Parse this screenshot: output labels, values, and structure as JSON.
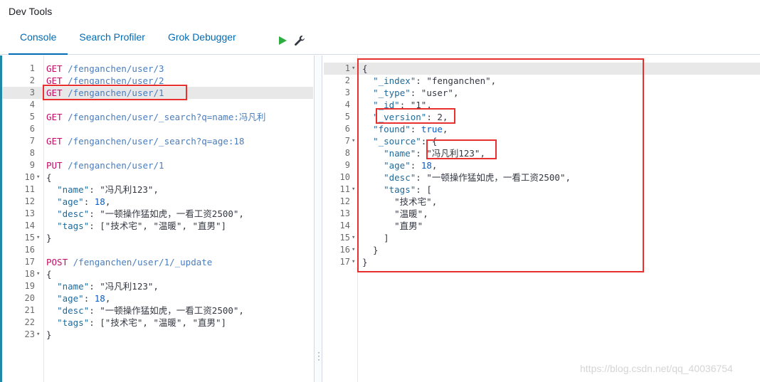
{
  "app": {
    "title": "Dev Tools"
  },
  "tabs": [
    {
      "label": "Console",
      "active": true
    },
    {
      "label": "Search Profiler",
      "active": false
    },
    {
      "label": "Grok Debugger",
      "active": false
    }
  ],
  "request_editor": {
    "lines": [
      {
        "n": "1",
        "tokens": [
          [
            "m",
            "GET "
          ],
          [
            "p",
            "/fenganchen/user/3"
          ]
        ]
      },
      {
        "n": "2",
        "tokens": [
          [
            "m",
            "GET "
          ],
          [
            "p",
            "/fenganchen/user/2"
          ]
        ]
      },
      {
        "n": "3",
        "tokens": [
          [
            "m",
            "GET "
          ],
          [
            "p",
            "/fenganchen/user/1"
          ]
        ],
        "active": true
      },
      {
        "n": "4",
        "tokens": []
      },
      {
        "n": "5",
        "tokens": [
          [
            "m",
            "GET "
          ],
          [
            "p",
            "/fenganchen/user/_search?q=name:冯凡利"
          ]
        ]
      },
      {
        "n": "6",
        "tokens": []
      },
      {
        "n": "7",
        "tokens": [
          [
            "m",
            "GET "
          ],
          [
            "p",
            "/fenganchen/user/_search?q=age:18"
          ]
        ]
      },
      {
        "n": "8",
        "tokens": []
      },
      {
        "n": "9",
        "tokens": [
          [
            "m",
            "PUT "
          ],
          [
            "p",
            "/fenganchen/user/1"
          ]
        ]
      },
      {
        "n": "10",
        "fold": true,
        "tokens": [
          [
            "s",
            "{"
          ]
        ]
      },
      {
        "n": "11",
        "tokens": [
          [
            "s",
            "  "
          ],
          [
            "k",
            "\"name\""
          ],
          [
            "s",
            ": \"冯凡利123\","
          ]
        ]
      },
      {
        "n": "12",
        "tokens": [
          [
            "s",
            "  "
          ],
          [
            "k",
            "\"age\""
          ],
          [
            "s",
            ": "
          ],
          [
            "n",
            "18"
          ],
          [
            "s",
            ","
          ]
        ]
      },
      {
        "n": "13",
        "tokens": [
          [
            "s",
            "  "
          ],
          [
            "k",
            "\"desc\""
          ],
          [
            "s",
            ": \"一顿操作猛如虎，一看工资2500\","
          ]
        ]
      },
      {
        "n": "14",
        "tokens": [
          [
            "s",
            "  "
          ],
          [
            "k",
            "\"tags\""
          ],
          [
            "s",
            ": [\"技术宅\", \"温暖\", \"直男\"]"
          ]
        ]
      },
      {
        "n": "15",
        "fold": true,
        "tokens": [
          [
            "s",
            "}"
          ]
        ]
      },
      {
        "n": "16",
        "tokens": []
      },
      {
        "n": "17",
        "tokens": [
          [
            "m",
            "POST "
          ],
          [
            "p",
            "/fenganchen/user/1/_update"
          ]
        ]
      },
      {
        "n": "18",
        "fold": true,
        "tokens": [
          [
            "s",
            "{"
          ]
        ]
      },
      {
        "n": "19",
        "tokens": [
          [
            "s",
            "  "
          ],
          [
            "k",
            "\"name\""
          ],
          [
            "s",
            ": \"冯凡利123\","
          ]
        ]
      },
      {
        "n": "20",
        "tokens": [
          [
            "s",
            "  "
          ],
          [
            "k",
            "\"age\""
          ],
          [
            "s",
            ": "
          ],
          [
            "n",
            "18"
          ],
          [
            "s",
            ","
          ]
        ]
      },
      {
        "n": "21",
        "tokens": [
          [
            "s",
            "  "
          ],
          [
            "k",
            "\"desc\""
          ],
          [
            "s",
            ": \"一顿操作猛如虎，一看工资2500\","
          ]
        ]
      },
      {
        "n": "22",
        "tokens": [
          [
            "s",
            "  "
          ],
          [
            "k",
            "\"tags\""
          ],
          [
            "s",
            ": [\"技术宅\", \"温暖\", \"直男\"]"
          ]
        ]
      },
      {
        "n": "23",
        "fold": true,
        "tokens": [
          [
            "s",
            "}"
          ]
        ]
      }
    ]
  },
  "response_editor": {
    "lines": [
      {
        "n": "1",
        "fold": true,
        "tokens": [
          [
            "s",
            "{"
          ]
        ],
        "active": true
      },
      {
        "n": "2",
        "tokens": [
          [
            "s",
            "  "
          ],
          [
            "k",
            "\"_index\""
          ],
          [
            "s",
            ": \"fenganchen\","
          ]
        ]
      },
      {
        "n": "3",
        "tokens": [
          [
            "s",
            "  "
          ],
          [
            "k",
            "\"_type\""
          ],
          [
            "s",
            ": \"user\","
          ]
        ]
      },
      {
        "n": "4",
        "tokens": [
          [
            "s",
            "  "
          ],
          [
            "k",
            "\"_id\""
          ],
          [
            "s",
            ": \"1\","
          ]
        ]
      },
      {
        "n": "5",
        "tokens": [
          [
            "s",
            "  "
          ],
          [
            "k",
            "\"_version\""
          ],
          [
            "s",
            ": 2,"
          ]
        ]
      },
      {
        "n": "6",
        "tokens": [
          [
            "s",
            "  "
          ],
          [
            "k",
            "\"found\""
          ],
          [
            "s",
            ": "
          ],
          [
            "b",
            "true"
          ],
          [
            "s",
            ","
          ]
        ]
      },
      {
        "n": "7",
        "fold": true,
        "tokens": [
          [
            "s",
            "  "
          ],
          [
            "k",
            "\"_source\""
          ],
          [
            "s",
            ": {"
          ]
        ]
      },
      {
        "n": "8",
        "tokens": [
          [
            "s",
            "    "
          ],
          [
            "k",
            "\"name\""
          ],
          [
            "s",
            ": \"冯凡利123\","
          ]
        ]
      },
      {
        "n": "9",
        "tokens": [
          [
            "s",
            "    "
          ],
          [
            "k",
            "\"age\""
          ],
          [
            "s",
            ": "
          ],
          [
            "n",
            "18"
          ],
          [
            "s",
            ","
          ]
        ]
      },
      {
        "n": "10",
        "tokens": [
          [
            "s",
            "    "
          ],
          [
            "k",
            "\"desc\""
          ],
          [
            "s",
            ": \"一顿操作猛如虎，一看工资2500\","
          ]
        ]
      },
      {
        "n": "11",
        "fold": true,
        "tokens": [
          [
            "s",
            "    "
          ],
          [
            "k",
            "\"tags\""
          ],
          [
            "s",
            ": ["
          ]
        ]
      },
      {
        "n": "12",
        "tokens": [
          [
            "s",
            "      \"技术宅\","
          ]
        ]
      },
      {
        "n": "13",
        "tokens": [
          [
            "s",
            "      \"温暖\","
          ]
        ]
      },
      {
        "n": "14",
        "tokens": [
          [
            "s",
            "      \"直男\""
          ]
        ]
      },
      {
        "n": "15",
        "fold": true,
        "tokens": [
          [
            "s",
            "    ]"
          ]
        ]
      },
      {
        "n": "16",
        "fold": true,
        "tokens": [
          [
            "s",
            "  }"
          ]
        ]
      },
      {
        "n": "17",
        "fold": true,
        "tokens": [
          [
            "s",
            "}"
          ]
        ]
      }
    ]
  },
  "icons": {
    "run": "play-icon",
    "settings": "wrench-icon",
    "resize": "vertical-dots-icon"
  },
  "watermark": "https://blog.csdn.net/qq_40036754",
  "colors": {
    "accent": "#006bb4",
    "method": "#c80a68",
    "path": "#4a7dbd",
    "annotation": "#e8302f"
  }
}
